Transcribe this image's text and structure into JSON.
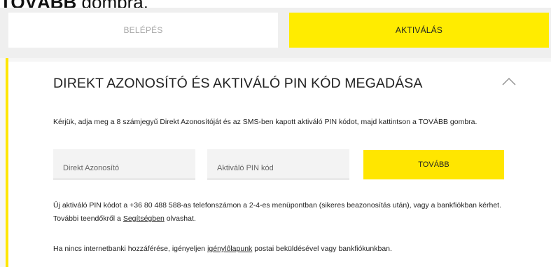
{
  "header": {
    "button_name": "TOVÁBB",
    "suffix": " gombra."
  },
  "tabs": [
    {
      "label": "BELÉPÉS"
    },
    {
      "label": "AKTIVÁLÁS"
    }
  ],
  "colors": {
    "accent": "#ffe600",
    "panel_bg": "#f6f6f6"
  },
  "section": {
    "title": "DIREKT AZONOSÍTÓ ÉS AKTIVÁLÓ PIN KÓD MEGADÁSA",
    "collapse_icon": "chevron-up-icon",
    "intro": "Kérjük, adja meg a 8 számjegyű Direkt Azonosítóját és az SMS-ben kapott aktiváló PIN kódot, majd kattintson a TOVÁBB gombra."
  },
  "form": {
    "id_placeholder": "Direkt Azonosító",
    "pin_placeholder": "Aktiváló PIN kód",
    "submit_label": "TOVÁBB"
  },
  "info": {
    "text_before": "Új aktiváló PIN kódot a +36 80 488 588-as telefonszámon a 2-4-es menüpontban (sikeres beazonosítás után), vagy a bankfiókban kérhet. További teendőkről a ",
    "help_link": "Segítségben",
    "text_after": " olvashat."
  },
  "info2": {
    "text_before": "Ha nincs internetbanki hozzáférése, igényeljen ",
    "form_link": "igénylőlapunk",
    "text_after": " postai beküldésével vagy bankfiókunkban."
  }
}
